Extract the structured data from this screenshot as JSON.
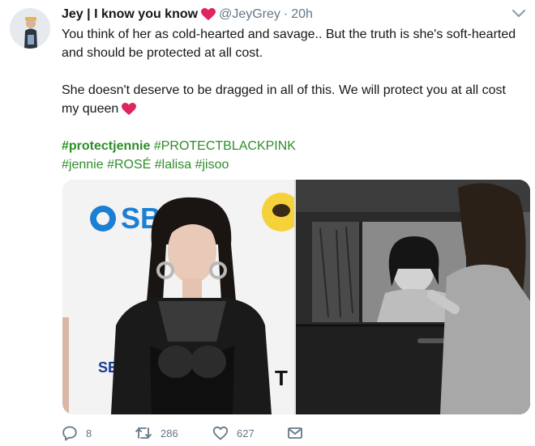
{
  "tweet": {
    "display_name": "Jey | I know you know",
    "name_emoji_icon": "red-heart-icon",
    "handle": "@JeyGrey",
    "separator": "·",
    "time": "20h",
    "lines": [
      "You think of her as cold-hearted and savage.. But the truth is she's soft-hearted",
      "and should be protected at all cost.",
      "She doesn't deserve to be dragged in all of this. We will protect you at all cost",
      "my queen"
    ],
    "hashtags_row1": [
      "#protectjennie",
      "#PROTECTBLACKPINK"
    ],
    "hashtags_row2": [
      "#jennie",
      "#ROSÉ",
      "#lalisa",
      "#jisoo"
    ],
    "media_logo_text": "SB",
    "media_sign_text": "SE",
    "media_brand_text": "T"
  },
  "actions": {
    "reply_count": "8",
    "retweet_count": "286",
    "like_count": "627"
  },
  "colors": {
    "hashtag": "#2f8d2a",
    "meta": "#657786",
    "heart": "#e0245e"
  }
}
